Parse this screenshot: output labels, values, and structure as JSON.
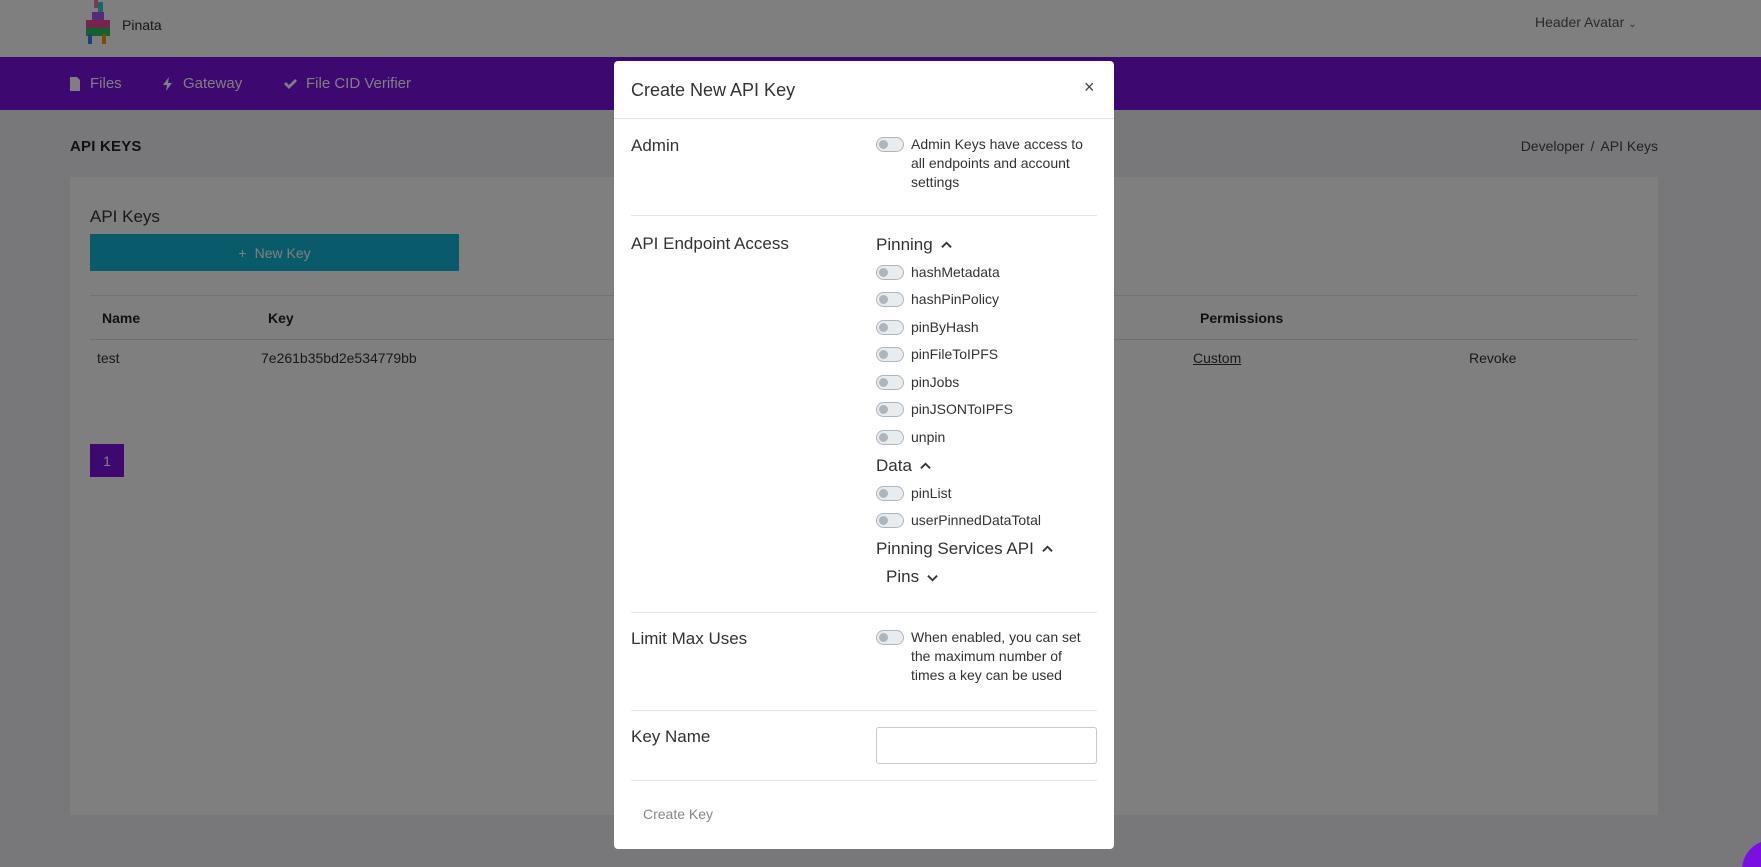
{
  "header": {
    "brand": "Pinata",
    "avatar_alt": "Header Avatar"
  },
  "nav": {
    "items": [
      {
        "label": "Files",
        "icon": "file-icon"
      },
      {
        "label": "Gateway",
        "icon": "bolt-icon"
      },
      {
        "label": "File CID Verifier",
        "icon": "double-check-icon"
      }
    ]
  },
  "page": {
    "title": "API KEYS",
    "breadcrumb": [
      "Developer",
      "API Keys"
    ],
    "card_title": "API Keys",
    "new_key_label": "New Key",
    "table": {
      "headers": [
        "Name",
        "Key",
        "Permissions"
      ],
      "rows": [
        {
          "name": "test",
          "key": "7e261b35bd2e534779bb",
          "permissions": "Custom",
          "action": "Revoke"
        }
      ]
    },
    "pagination": {
      "current": "1"
    }
  },
  "modal": {
    "title": "Create New API Key",
    "close": "×",
    "admin": {
      "label": "Admin",
      "desc": "Admin Keys have access to all endpoints and account settings"
    },
    "endpoint_access": {
      "label": "API Endpoint Access",
      "groups": [
        {
          "name": "Pinning",
          "expanded": true,
          "items": [
            "hashMetadata",
            "hashPinPolicy",
            "pinByHash",
            "pinFileToIPFS",
            "pinJobs",
            "pinJSONToIPFS",
            "unpin"
          ]
        },
        {
          "name": "Data",
          "expanded": true,
          "items": [
            "pinList",
            "userPinnedDataTotal"
          ]
        },
        {
          "name": "Pinning Services API",
          "expanded": true,
          "subgroups": [
            {
              "name": "Pins",
              "expanded": false
            }
          ]
        }
      ]
    },
    "limit_max_uses": {
      "label": "Limit Max Uses",
      "desc": "When enabled, you can set the maximum number of times a key can be used"
    },
    "key_name": {
      "label": "Key Name",
      "value": "",
      "placeholder": ""
    },
    "create_label": "Create Key"
  },
  "colors": {
    "nav_purple": "#7a10e0",
    "new_key_teal": "#12b7d8",
    "overlay": "rgba(0,0,0,0.5)"
  }
}
